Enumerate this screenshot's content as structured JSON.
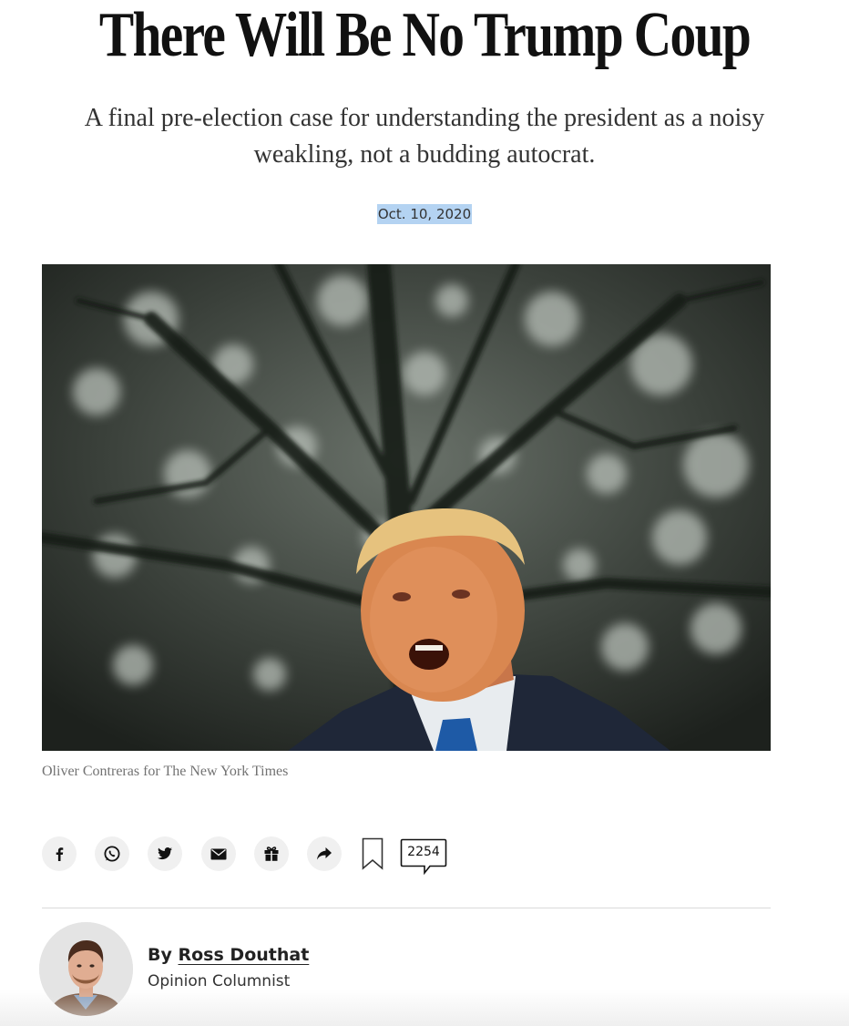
{
  "article": {
    "headline": "There Will Be No Trump Coup",
    "summary": "A final pre-election case for understanding the president as a noisy weakling, not a budding autocrat.",
    "date": "Oct. 10, 2020",
    "photo_credit": "Oliver Contreras for The New York Times"
  },
  "share_bar": {
    "buttons": [
      {
        "icon": "facebook-icon"
      },
      {
        "icon": "whatsapp-icon"
      },
      {
        "icon": "twitter-icon"
      },
      {
        "icon": "email-icon"
      },
      {
        "icon": "gift-icon"
      },
      {
        "icon": "share-arrow-icon"
      }
    ],
    "bookmark_icon": "bookmark-icon",
    "comment_count": "2254"
  },
  "byline": {
    "prefix": "By",
    "author": "Ross Douthat",
    "role": "Opinion Columnist"
  },
  "colors": {
    "text": "#121212",
    "date_highlight": "#b4d3f2",
    "credit": "#727272",
    "button_bg": "#f0f0f0"
  }
}
